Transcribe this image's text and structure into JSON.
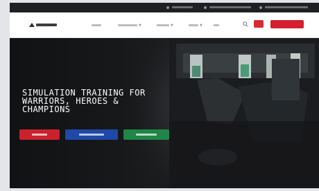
{
  "hero": {
    "title_lines": [
      "SIMULATION TRAINING FOR",
      "WARRIORS, HEROES &",
      "CHAMPIONS"
    ]
  },
  "colors": {
    "primary_red": "#d41f2f",
    "button_blue": "#1f49a7",
    "button_green": "#1f8648",
    "topbar": "#1f2023"
  },
  "icons": [
    "logo-mark",
    "search-icon"
  ]
}
